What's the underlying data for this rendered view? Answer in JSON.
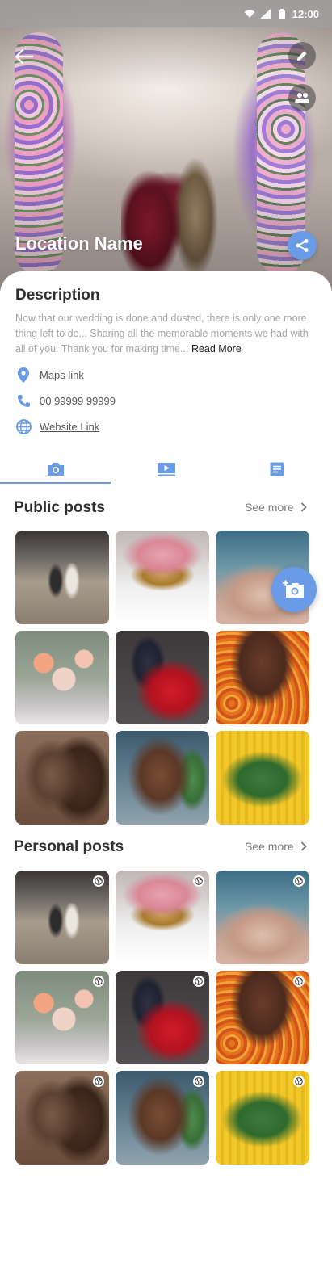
{
  "status_bar": {
    "time": "12:00"
  },
  "hero": {
    "location_name": "Location Name"
  },
  "description": {
    "title": "Description",
    "text": "Now that our wedding is done and dusted, there is only one more thing left to do... Sharing all the memorable moments we had  with all of you. Thank you for making time...",
    "read_more": "Read More"
  },
  "info": {
    "maps_link": "Maps link",
    "phone": "00 99999 99999",
    "website_link": "Website Link"
  },
  "tabs": [
    {
      "icon": "camera-icon",
      "active": true
    },
    {
      "icon": "video-icon",
      "active": false
    },
    {
      "icon": "notes-icon",
      "active": false
    }
  ],
  "public_posts": {
    "title": "Public posts",
    "see_more": "See more"
  },
  "personal_posts": {
    "title": "Personal posts",
    "see_more": "See more"
  },
  "colors": {
    "accent": "#6a9be6",
    "text_dark": "#2f2f2f",
    "text_muted": "#a6a6a6"
  }
}
